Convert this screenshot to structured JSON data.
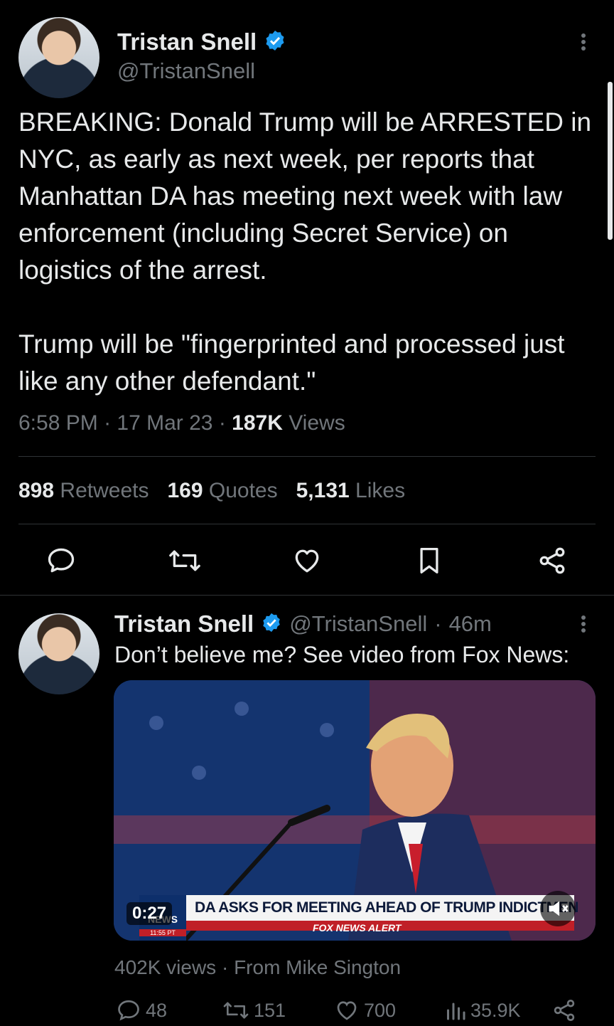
{
  "tweet": {
    "author_name": "Tristan Snell",
    "author_handle": "@TristanSnell",
    "text_p1": "BREAKING: Donald Trump will be ARRESTED in NYC, as early as next week, per reports that Manhattan DA has meeting next week with law enforcement (including Secret Service) on logistics of the arrest.",
    "text_p2": "Trump will be \"fingerprinted and processed just like any other defendant.\"",
    "time": "6:58 PM",
    "date": "17 Mar 23",
    "views_count": "187K",
    "views_label": "Views",
    "retweets_count": "898",
    "retweets_label": "Retweets",
    "quotes_count": "169",
    "quotes_label": "Quotes",
    "likes_count": "5,131",
    "likes_label": "Likes"
  },
  "reply": {
    "author_name": "Tristan Snell",
    "author_handle": "@TristanSnell",
    "age": "46m",
    "text": "Don’t believe me? See video from Fox News:",
    "video": {
      "duration": "0:27",
      "chyron": "DA ASKS FOR MEETING AHEAD OF TRUMP INDICTMEN",
      "alert": "FOX NEWS ALERT",
      "network": "NEWS",
      "clock": "11:55 PT"
    },
    "views_text": "402K views",
    "from_text": "From Mike Sington",
    "replies": "48",
    "retweets": "151",
    "likes": "700",
    "views": "35.9K"
  },
  "colors": {
    "background": "#000000",
    "text": "#e7e9ea",
    "muted": "#71767b",
    "verified": "#1d9bf0",
    "divider": "#2f3336"
  },
  "icons": [
    "verified-badge-icon",
    "more-icon",
    "reply-icon",
    "retweet-icon",
    "like-icon",
    "bookmark-icon",
    "share-icon",
    "mute-icon",
    "analytics-icon"
  ]
}
